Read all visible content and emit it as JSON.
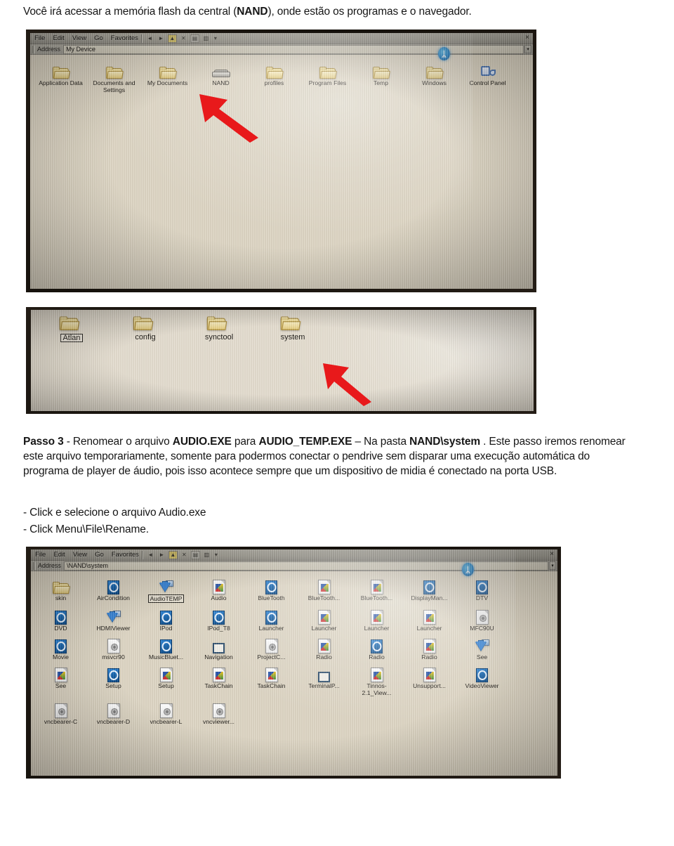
{
  "document": {
    "intro": {
      "prefix": "Você irá acessar a memória flash da central (",
      "bold": "NAND",
      "suffix": "), onde estão os programas e o navegador."
    },
    "passo": {
      "line1_a": "Passo 3",
      "line1_b": " -  Renomear o arquivo ",
      "line1_c": "AUDIO.EXE",
      "line1_d": " para ",
      "line1_e": "AUDIO_TEMP.EXE",
      "line1_f": " – Na pasta ",
      "line1_g": "NAND\\system",
      "line1_h": " . Este passo iremos renomear",
      "line2": "este arquivo temporariamente, somente para podermos conectar o pendrive sem disparar uma execução automática do",
      "line3": "programa de player de áudio, pois isso acontece sempre que um dispositivo de midia é conectado na porta USB."
    },
    "bullets": [
      "- Click e selecione o arquivo Audio.exe",
      "- Click Menu\\File\\Rename."
    ]
  },
  "photo_top": {
    "menu": [
      "File",
      "Edit",
      "View",
      "Go",
      "Favorites"
    ],
    "toolbar_icons": [
      "back-icon",
      "forward-icon",
      "up-folder-icon",
      "delete-icon",
      "properties-icon",
      "view-list-icon",
      "dropdown-icon"
    ],
    "close_label": "×",
    "address_label": "Address",
    "address_value": "My Device",
    "bluetooth_glyph": "ᛦ",
    "items": [
      {
        "caption": "Application Data",
        "icon": "folder-icon"
      },
      {
        "caption": "Documents and Settings",
        "icon": "folder-icon"
      },
      {
        "caption": "My Documents",
        "icon": "folder-icon"
      },
      {
        "caption": "NAND",
        "icon": "drive-icon"
      },
      {
        "caption": "profiles",
        "icon": "folder-icon"
      },
      {
        "caption": "Program Files",
        "icon": "folder-icon"
      },
      {
        "caption": "Temp",
        "icon": "folder-icon"
      },
      {
        "caption": "Windows",
        "icon": "folder-icon"
      },
      {
        "caption": "Control Panel",
        "icon": "control-panel-icon"
      }
    ]
  },
  "photo_middle": {
    "items": [
      {
        "caption": "Atlan",
        "icon": "folder-icon",
        "selected": true
      },
      {
        "caption": "config",
        "icon": "folder-icon",
        "selected": false
      },
      {
        "caption": "synctool",
        "icon": "folder-icon",
        "selected": false
      },
      {
        "caption": "system",
        "icon": "folder-icon",
        "selected": false
      }
    ]
  },
  "photo_bottom": {
    "menu": [
      "File",
      "Edit",
      "View",
      "Go",
      "Favorites"
    ],
    "close_label": "×",
    "address_label": "Address",
    "address_value": "\\NAND\\system",
    "bluetooth_glyph": "ᛦ",
    "items": [
      {
        "caption": "skin",
        "icon": "folder-icon",
        "selected": false
      },
      {
        "caption": "AirCondition",
        "icon": "app-icon",
        "selected": false
      },
      {
        "caption": "AudioTEMP",
        "icon": "installer-icon",
        "selected": true
      },
      {
        "caption": "Audio",
        "icon": "exe-doc-icon",
        "selected": false
      },
      {
        "caption": "BlueTooth",
        "icon": "app-icon",
        "selected": false
      },
      {
        "caption": "BlueTooth...",
        "icon": "exe-doc-icon",
        "selected": false
      },
      {
        "caption": "BlueTooth...",
        "icon": "exe-doc-icon",
        "selected": false
      },
      {
        "caption": "DisplayMan...",
        "icon": "app-icon",
        "selected": false
      },
      {
        "caption": "DTV",
        "icon": "app-icon",
        "selected": false
      },
      {
        "caption": "DVD",
        "icon": "app-icon",
        "selected": false
      },
      {
        "caption": "HDMIViewer",
        "icon": "installer-icon",
        "selected": false
      },
      {
        "caption": "IPod",
        "icon": "app-icon",
        "selected": false
      },
      {
        "caption": "IPod_T8",
        "icon": "app-icon",
        "selected": false
      },
      {
        "caption": "Launcher",
        "icon": "app-icon",
        "selected": false
      },
      {
        "caption": "Launcher",
        "icon": "exe-doc-icon",
        "selected": false
      },
      {
        "caption": "Launcher",
        "icon": "exe-doc-icon",
        "selected": false
      },
      {
        "caption": "Launcher",
        "icon": "exe-doc-icon",
        "selected": false
      },
      {
        "caption": "MFC90U",
        "icon": "dll-doc-icon",
        "selected": false
      },
      {
        "caption": "Movie",
        "icon": "app-icon",
        "selected": false
      },
      {
        "caption": "msvcr90",
        "icon": "dll-doc-icon",
        "selected": false
      },
      {
        "caption": "MusicBluet...",
        "icon": "app-icon",
        "selected": false
      },
      {
        "caption": "Navigation",
        "icon": "window-icon",
        "selected": false
      },
      {
        "caption": "ProjectC...",
        "icon": "dll-doc-icon",
        "selected": false
      },
      {
        "caption": "Radio",
        "icon": "exe-doc-icon",
        "selected": false
      },
      {
        "caption": "Radio",
        "icon": "app-icon",
        "selected": false
      },
      {
        "caption": "Radio",
        "icon": "exe-doc-icon",
        "selected": false
      },
      {
        "caption": "See",
        "icon": "installer-icon",
        "selected": false
      },
      {
        "caption": "See",
        "icon": "exe-doc-icon",
        "selected": false
      },
      {
        "caption": "Setup",
        "icon": "app-icon",
        "selected": false
      },
      {
        "caption": "Setup",
        "icon": "exe-doc-icon",
        "selected": false
      },
      {
        "caption": "TaskChain",
        "icon": "exe-doc-icon",
        "selected": false
      },
      {
        "caption": "TaskChain",
        "icon": "exe-doc-icon",
        "selected": false
      },
      {
        "caption": "TerminalP...",
        "icon": "window-icon",
        "selected": false
      },
      {
        "caption": "Tinnos-2.1_View...",
        "icon": "exe-doc-icon",
        "selected": false
      },
      {
        "caption": "Unsupport...",
        "icon": "exe-doc-icon",
        "selected": false
      },
      {
        "caption": "VideoViewer",
        "icon": "app-icon",
        "selected": false
      },
      {
        "caption": "vncbearer-C",
        "icon": "dll-doc-icon",
        "selected": false
      },
      {
        "caption": "vncbearer-D",
        "icon": "dll-doc-icon",
        "selected": false
      },
      {
        "caption": "vncbearer-L",
        "icon": "dll-doc-icon",
        "selected": false
      },
      {
        "caption": "vncviewer...",
        "icon": "dll-doc-icon",
        "selected": false
      }
    ]
  },
  "annotations": {
    "arrow_color": "#e8191b",
    "arrow_top_target": "NAND",
    "arrow_middle_target": "system"
  }
}
